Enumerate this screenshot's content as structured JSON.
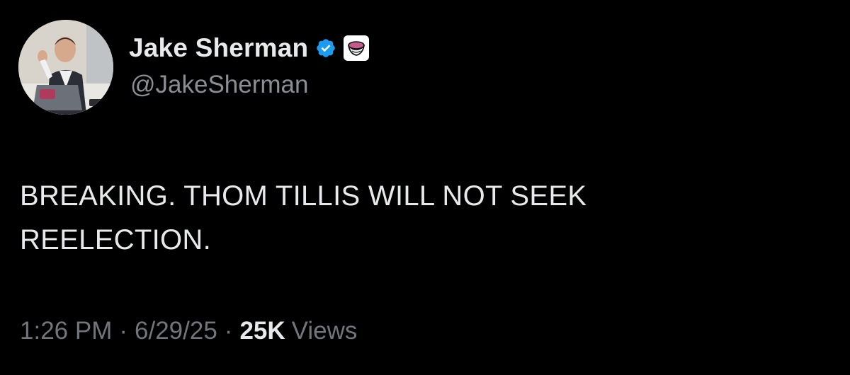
{
  "author": {
    "display_name": "Jake Sherman",
    "handle": "@JakeSherman",
    "verified_color": "#1d9bf0",
    "verified_icon": "verified-badge-icon",
    "affiliate_icon": "affiliate-logo-icon"
  },
  "tweet": {
    "text_line1": "BREAKING. THOM TILLIS WILL NOT SEEK",
    "text_line2": "REELECTION."
  },
  "meta": {
    "time": "1:26 PM",
    "date": "6/29/25",
    "separator": "·",
    "views_count": "25K",
    "views_label": "Views"
  },
  "colors": {
    "background": "#000000",
    "primary_text": "#e7e9ea",
    "secondary_text": "#71767b"
  }
}
